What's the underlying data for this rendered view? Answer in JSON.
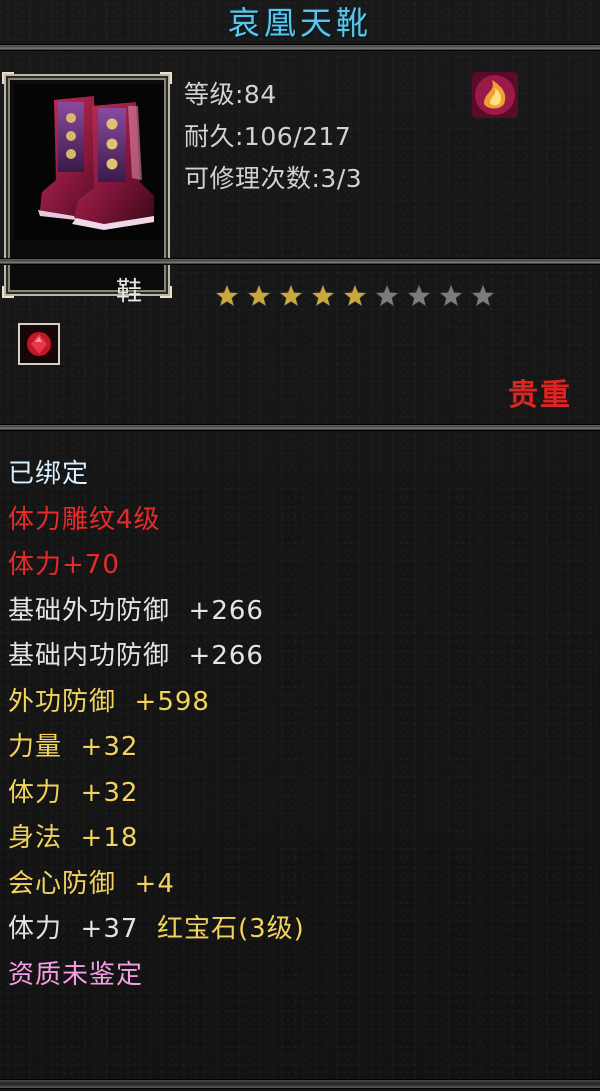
{
  "item": {
    "name": "哀凰天靴",
    "level_label": "等级:84",
    "durability_label": "耐久:106/217",
    "repair_label": "可修理次数:3/3",
    "icon": "boots-icon",
    "class_icon": "flame-class-icon",
    "slot": "鞋",
    "stars_total": 9,
    "stars_filled": 5,
    "gem_icon": "red-gem-icon",
    "rarity": "贵重",
    "colors": {
      "title": "#5cc4e6",
      "bound": "#d9f0ff",
      "red": "#e82a2a",
      "light": "#e4e4e4",
      "yellow": "#f2d35c",
      "pink": "#f79ce4",
      "star_gold": "#c9a83c",
      "star_grey": "#7c7c7c"
    }
  },
  "attributes": {
    "bound": "已绑定",
    "engrave": "体力雕纹4级",
    "engrave_bonus": "体力+70",
    "base_outer_def": "基础外功防御",
    "base_outer_def_val": "+266",
    "base_inner_def": "基础内功防御",
    "base_inner_def_val": "+266",
    "outer_def": "外功防御",
    "outer_def_val": "+598",
    "strength": "力量",
    "strength_val": "+32",
    "stamina": "体力",
    "stamina_val": "+32",
    "agility": "身法",
    "agility_val": "+18",
    "crit_def": "会心防御",
    "crit_def_val": "+4",
    "gem_stat": "体力",
    "gem_stat_val": "+37",
    "gem_name": "红宝石(3级)",
    "quality": "资质未鉴定"
  }
}
